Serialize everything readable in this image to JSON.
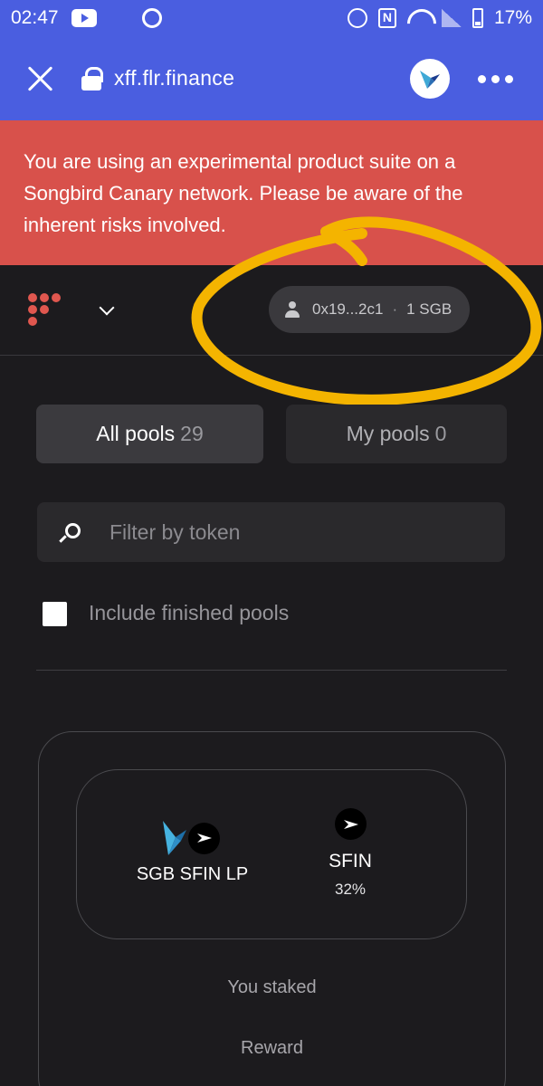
{
  "status_bar": {
    "time": "02:47",
    "battery": "17%",
    "icons": [
      "youtube-icon",
      "aperture-icon",
      "alarm-icon",
      "nfc-icon",
      "wifi-icon",
      "signal-icon",
      "battery-icon"
    ]
  },
  "browser": {
    "url": "xff.flr.finance",
    "accent": "#4a5ee0"
  },
  "warning": {
    "text": "You are using an experimental product suite on a Songbird Canary network. Please be aware of the inherent risks involved.",
    "color": "#d8514b"
  },
  "app_header": {
    "account_address": "0x19...2c1",
    "separator": "·",
    "account_balance": "1 SGB",
    "annotation_color": "#f4b400"
  },
  "tabs": [
    {
      "label": "All pools",
      "count": "29",
      "active": true
    },
    {
      "label": "My pools",
      "count": "0",
      "active": false
    }
  ],
  "filter": {
    "placeholder": "Filter by token",
    "value": ""
  },
  "include_finished": {
    "label": "Include finished pools",
    "checked": false
  },
  "pool_card": {
    "lp_name": "SGB SFIN LP",
    "reward_token": "SFIN",
    "reward_apr": "32%",
    "you_staked_label": "You staked",
    "reward_label": "Reward"
  }
}
